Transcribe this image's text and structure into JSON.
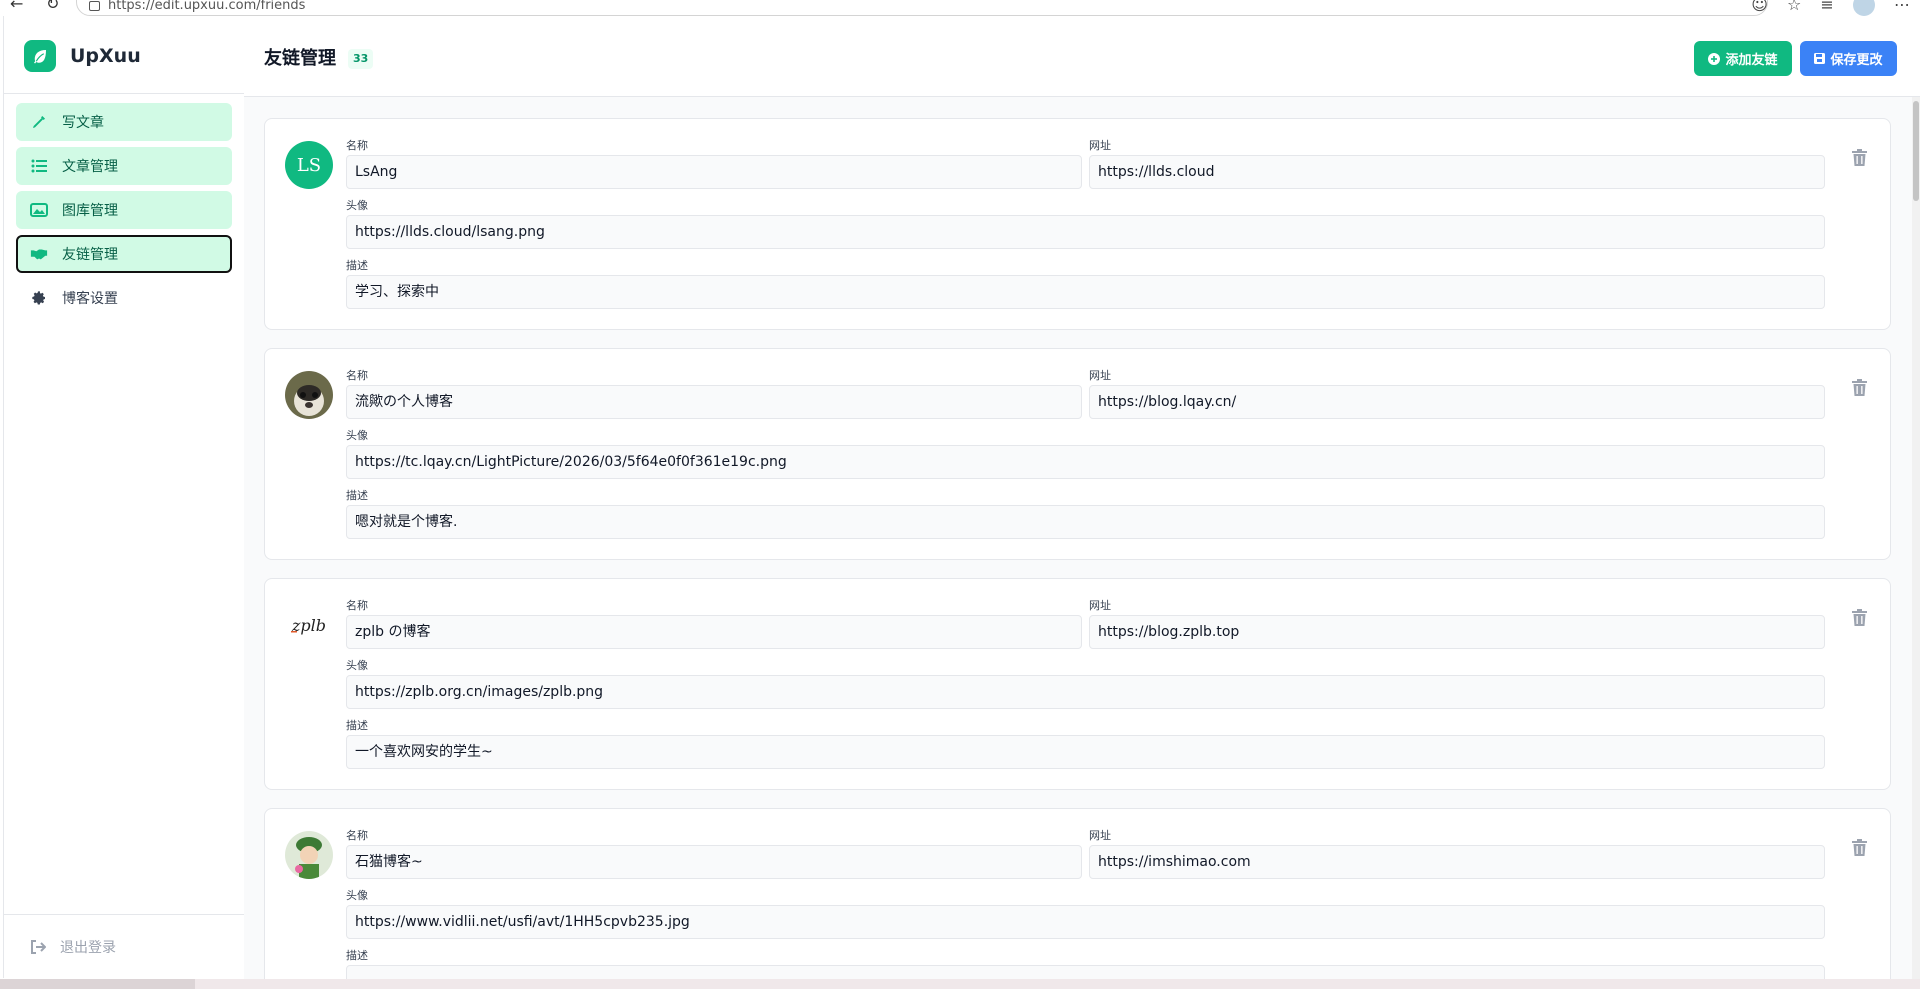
{
  "browser": {
    "url": "https://edit.upxuu.com/friends"
  },
  "brand": {
    "name": "UpXuu"
  },
  "nav": [
    {
      "label": "写文章",
      "icon": "pen-icon"
    },
    {
      "label": "文章管理",
      "icon": "list-icon"
    },
    {
      "label": "图库管理",
      "icon": "image-icon"
    },
    {
      "label": "友链管理",
      "icon": "handshake-icon"
    },
    {
      "label": "博客设置",
      "icon": "gear-icon"
    }
  ],
  "logout_label": "退出登录",
  "header": {
    "title": "友链管理",
    "count": "33",
    "add_label": "添加友链",
    "save_label": "保存更改"
  },
  "labels": {
    "name": "名称",
    "url": "网址",
    "avatar": "头像",
    "desc": "描述"
  },
  "friends": [
    {
      "initials": "LS",
      "name": "LsAng",
      "url": "https://llds.cloud",
      "avatar": "https://llds.cloud/lsang.png",
      "desc": "学习、探索中"
    },
    {
      "initials": "",
      "name": "流歟の个人博客",
      "url": "https://blog.lqay.cn/",
      "avatar": "https://tc.lqay.cn/LightPicture/2026/03/5f64e0f0f361e19c.png",
      "desc": "嗯对就是个博客."
    },
    {
      "initials": "zplb",
      "name": "zplb の博客",
      "url": "https://blog.zplb.top",
      "avatar": "https://zplb.org.cn/images/zplb.png",
      "desc": "一个喜欢网安的学生~"
    },
    {
      "initials": "",
      "name": "石猫博客~",
      "url": "https://imshimao.com",
      "avatar": "https://www.vidlii.net/usfi/avt/1HH5cpvb235.jpg",
      "desc": ""
    }
  ],
  "colors": {
    "accent": "#10b981",
    "primary": "#3b82f6",
    "nav_bg": "#d1fae5"
  }
}
